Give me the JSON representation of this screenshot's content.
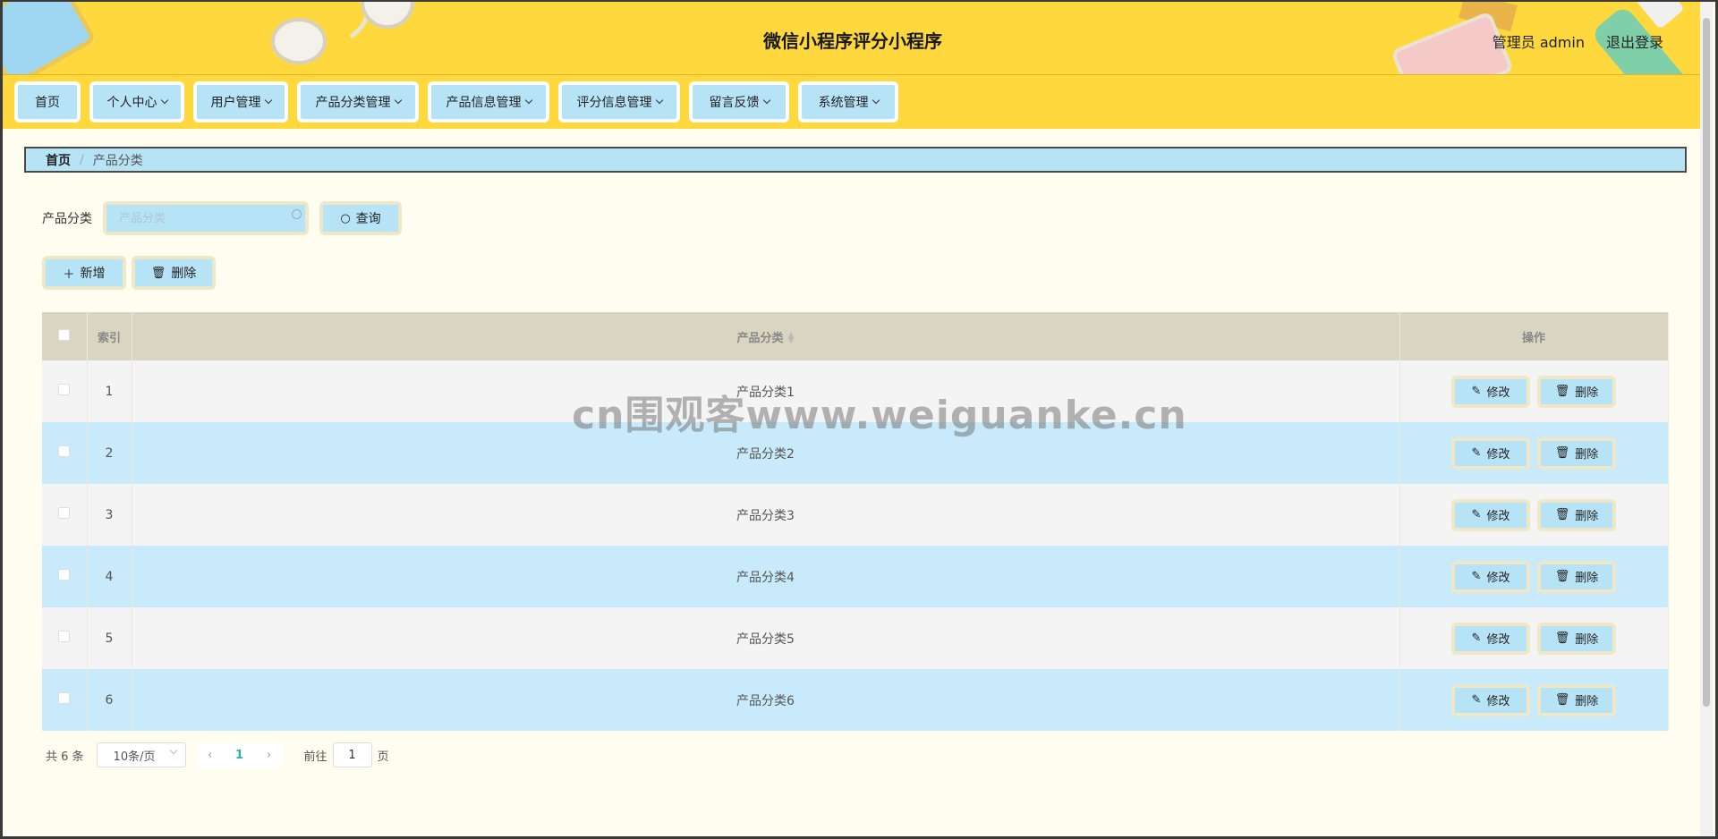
{
  "header": {
    "title": "微信小程序评分小程序",
    "user_label": "管理员 admin",
    "logout_label": "退出登录"
  },
  "nav": {
    "items": [
      {
        "label": "首页",
        "has_menu": false
      },
      {
        "label": "个人中心",
        "has_menu": true
      },
      {
        "label": "用户管理",
        "has_menu": true
      },
      {
        "label": "产品分类管理",
        "has_menu": true
      },
      {
        "label": "产品信息管理",
        "has_menu": true
      },
      {
        "label": "评分信息管理",
        "has_menu": true
      },
      {
        "label": "留言反馈",
        "has_menu": true
      },
      {
        "label": "系统管理",
        "has_menu": true
      }
    ]
  },
  "breadcrumb": {
    "home": "首页",
    "separator": "/",
    "current": "产品分类"
  },
  "search": {
    "label": "产品分类",
    "placeholder": "产品分类",
    "value": "",
    "button_label": "查询"
  },
  "actions": {
    "add_label": "新增",
    "delete_label": "删除"
  },
  "table": {
    "columns": {
      "index": "索引",
      "category": "产品分类",
      "operations": "操作"
    },
    "rows": [
      {
        "index": "1",
        "category": "产品分类1"
      },
      {
        "index": "2",
        "category": "产品分类2"
      },
      {
        "index": "3",
        "category": "产品分类3"
      },
      {
        "index": "4",
        "category": "产品分类4"
      },
      {
        "index": "5",
        "category": "产品分类5"
      },
      {
        "index": "6",
        "category": "产品分类6"
      }
    ],
    "edit_label": "修改",
    "delete_label": "删除"
  },
  "pagination": {
    "total": "共 6 条",
    "page_size": "10条/页",
    "current_page": "1",
    "goto_label": "前往",
    "goto_value": "1",
    "page_unit": "页"
  },
  "watermark": "cn围观客www.weiguanke.cn",
  "colors": {
    "header_bg": "#ffd83d",
    "button_bg": "#b7e3f6",
    "page_bg": "#fffdf0",
    "table_header_bg": "#d9d5c0",
    "row_alt_bg": "#c8eafa"
  }
}
